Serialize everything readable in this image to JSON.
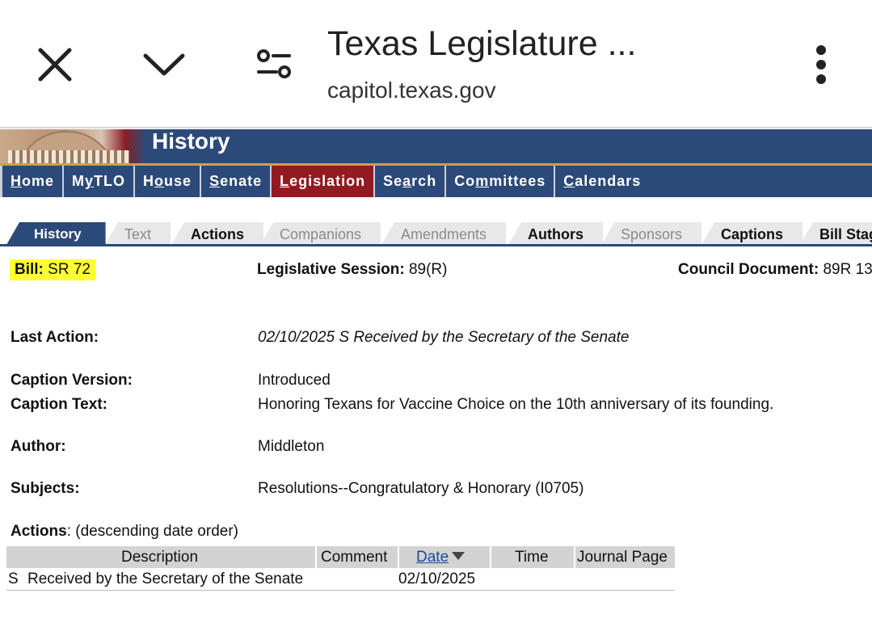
{
  "browser": {
    "title": "Texas Legislature ...",
    "url": "capitol.texas.gov",
    "icons": [
      "close-icon",
      "chevron-down-icon",
      "page-info-icon",
      "more-vert-icon"
    ]
  },
  "header": {
    "title": "History"
  },
  "nav": {
    "items": [
      {
        "pre": "",
        "u": "H",
        "post": "ome"
      },
      {
        "pre": "M",
        "u": "y",
        "post": " TLO"
      },
      {
        "pre": "H",
        "u": "o",
        "post": "use"
      },
      {
        "pre": "",
        "u": "S",
        "post": "enate"
      },
      {
        "pre": "",
        "u": "L",
        "post": "egislation"
      },
      {
        "pre": "Se",
        "u": "a",
        "post": "rch"
      },
      {
        "pre": "Co",
        "u": "m",
        "post": "mittees"
      },
      {
        "pre": "",
        "u": "C",
        "post": "alendars"
      }
    ],
    "active": "Legislation"
  },
  "tabs": [
    "History",
    "Text",
    "Actions",
    "Companions",
    "Amendments",
    "Authors",
    "Sponsors",
    "Captions",
    "Bill Stag"
  ],
  "bill": {
    "bill_label": "Bill:",
    "bill_value": "SR 72",
    "session_label": "Legislative Session:",
    "session_value": "89(R)",
    "council_label": "Council Document:",
    "council_value": "89R 13",
    "last_action_label": "Last Action:",
    "last_action_value": "02/10/2025 S Received by the Secretary of the Senate",
    "caption_version_label": "Caption Version:",
    "caption_version_value": "Introduced",
    "caption_text_label": "Caption Text:",
    "caption_text_value": "Honoring Texans for Vaccine Choice on the 10th anniversary of its founding.",
    "author_label": "Author:",
    "author_value": "Middleton",
    "subjects_label": "Subjects:",
    "subjects_value": "Resolutions--Congratulatory & Honorary (I0705)",
    "actions_label": "Actions",
    "actions_note": ": (descending date order)"
  },
  "actions_table": {
    "columns": [
      "Description",
      "Comment",
      "Date",
      "Time",
      "Journal Page"
    ],
    "rows": [
      {
        "chamber": "S",
        "description": "Received by the Secretary of the Senate",
        "comment": "",
        "date": "02/10/2025",
        "time": "",
        "journal_page": ""
      }
    ]
  },
  "colors": {
    "nav_bg": "#2c4a79",
    "nav_active": "#931a21",
    "highlight": "#ffff33",
    "link": "#1a4a9c"
  }
}
